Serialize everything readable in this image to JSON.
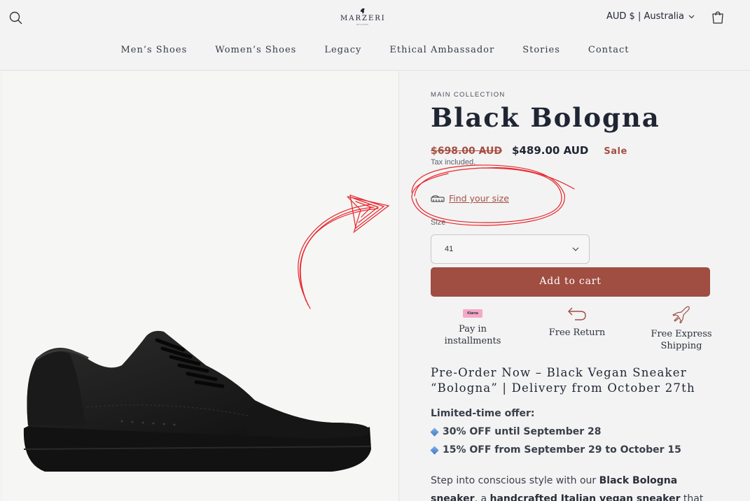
{
  "header": {
    "logo_text": "MARZERI",
    "logo_sub": "MILANO",
    "locale": "AUD $ | Australia",
    "nav": [
      "Men’s Shoes",
      "Women’s Shoes",
      "Legacy",
      "Ethical Ambassador",
      "Stories",
      "Contact"
    ]
  },
  "product": {
    "collection": "MAIN COLLECTION",
    "title": "Black Bologna",
    "old_price": "$698.00 AUD",
    "price": "$489.00 AUD",
    "sale_badge": "Sale",
    "tax_note": "Tax included.",
    "find_size": "Find your size",
    "size_label": "Size",
    "size_value": "41",
    "add_to_cart": "Add to cart",
    "features": [
      {
        "icon": "klarna-badge",
        "badge": "Klarna",
        "line1": "Pay in",
        "line2": "installments"
      },
      {
        "icon": "return-arrow-icon",
        "line1": "Free Return",
        "line2": ""
      },
      {
        "icon": "airplane-icon",
        "line1": "Free Express",
        "line2": "Shipping"
      }
    ],
    "preorder_heading": "Pre-Order Now – Black Vegan Sneaker “Bologna” | Delivery from October 27th",
    "offer_title": "Limited-time offer:",
    "offers": [
      "30% OFF until September 28",
      "15% OFF from September 29 to October 15"
    ],
    "desc_intro": "Step into conscious style with our ",
    "desc_bold1": "Black Bologna",
    "desc_mid": "sneaker",
    "desc_mid2": ", a ",
    "desc_bold2": "handcrafted Italian vegan sneaker",
    "desc_end": " that"
  },
  "colors": {
    "accent": "#a04d42",
    "background": "#f3f3f3",
    "annotation": "#e8232a"
  }
}
